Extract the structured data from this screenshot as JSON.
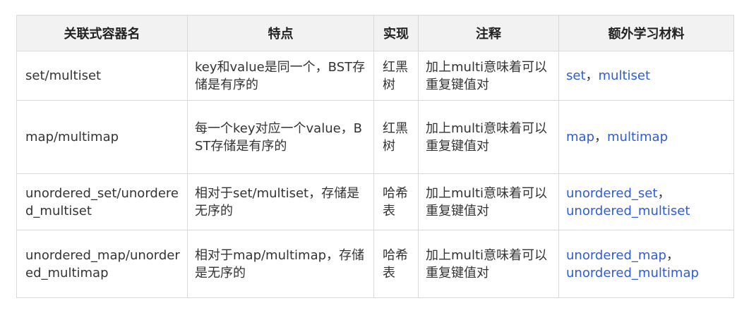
{
  "headers": [
    "关联式容器名",
    "特点",
    "实现",
    "注释",
    "额外学习材料"
  ],
  "rows": [
    {
      "name": "set/multiset",
      "feature": "key和value是同一个，BST存储是有序的",
      "impl": "红黑树",
      "note": "加上multi意味着可以重复键值对",
      "links": [
        "set",
        "multiset"
      ]
    },
    {
      "name": "map/multimap",
      "feature": "每一个key对应一个value，BST存储是有序的",
      "impl": "红黑树",
      "note": "加上multi意味着可以重复键值对",
      "links": [
        "map",
        "multimap"
      ]
    },
    {
      "name": "unordered_set/unordered_multiset",
      "feature": "相对于set/multiset，存储是无序的",
      "impl": "哈希表",
      "note": "加上multi意味着可以重复键值对",
      "links": [
        "unordered_set",
        "unordered_multiset"
      ]
    },
    {
      "name": "unordered_map/unordered_multimap",
      "feature": "相对于map/multimap，存储是无序的",
      "impl": "哈希表",
      "note": "加上multi意味着可以重复键值对",
      "links": [
        "unordered_map",
        "unordered_multimap"
      ]
    }
  ],
  "link_separator": "，"
}
